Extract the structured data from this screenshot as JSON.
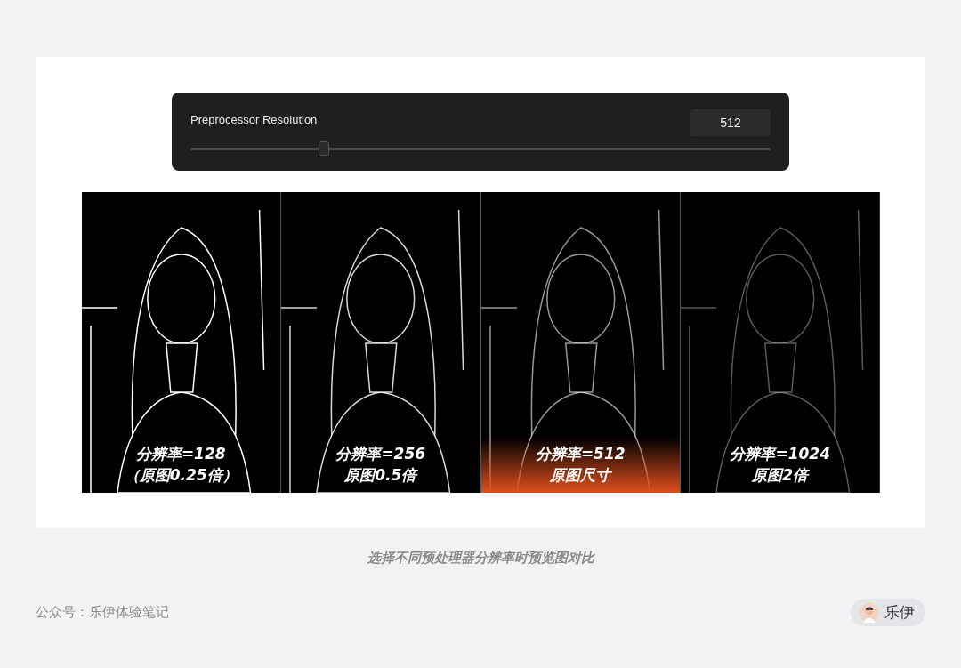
{
  "slider": {
    "label": "Preprocessor Resolution",
    "value": "512",
    "level": 0.23
  },
  "panels": [
    {
      "kind": "picture",
      "line1": "分辨率=128",
      "line2": "（原图0.25倍）",
      "selected": false
    },
    {
      "kind": "picture",
      "line1": "分辨率=256",
      "line2": "原图0.5倍",
      "selected": false
    },
    {
      "kind": "picture",
      "line1": "分辨率=512",
      "line2": "原图尺寸",
      "selected": true
    },
    {
      "kind": "picture",
      "line1": "分辨率=1024",
      "line2": "原图2倍",
      "selected": false
    }
  ],
  "caption": "选择不同预处理器分辨率时预览图对比",
  "footer": {
    "source": "公众号：乐伊体验笔记",
    "author": "乐伊"
  }
}
